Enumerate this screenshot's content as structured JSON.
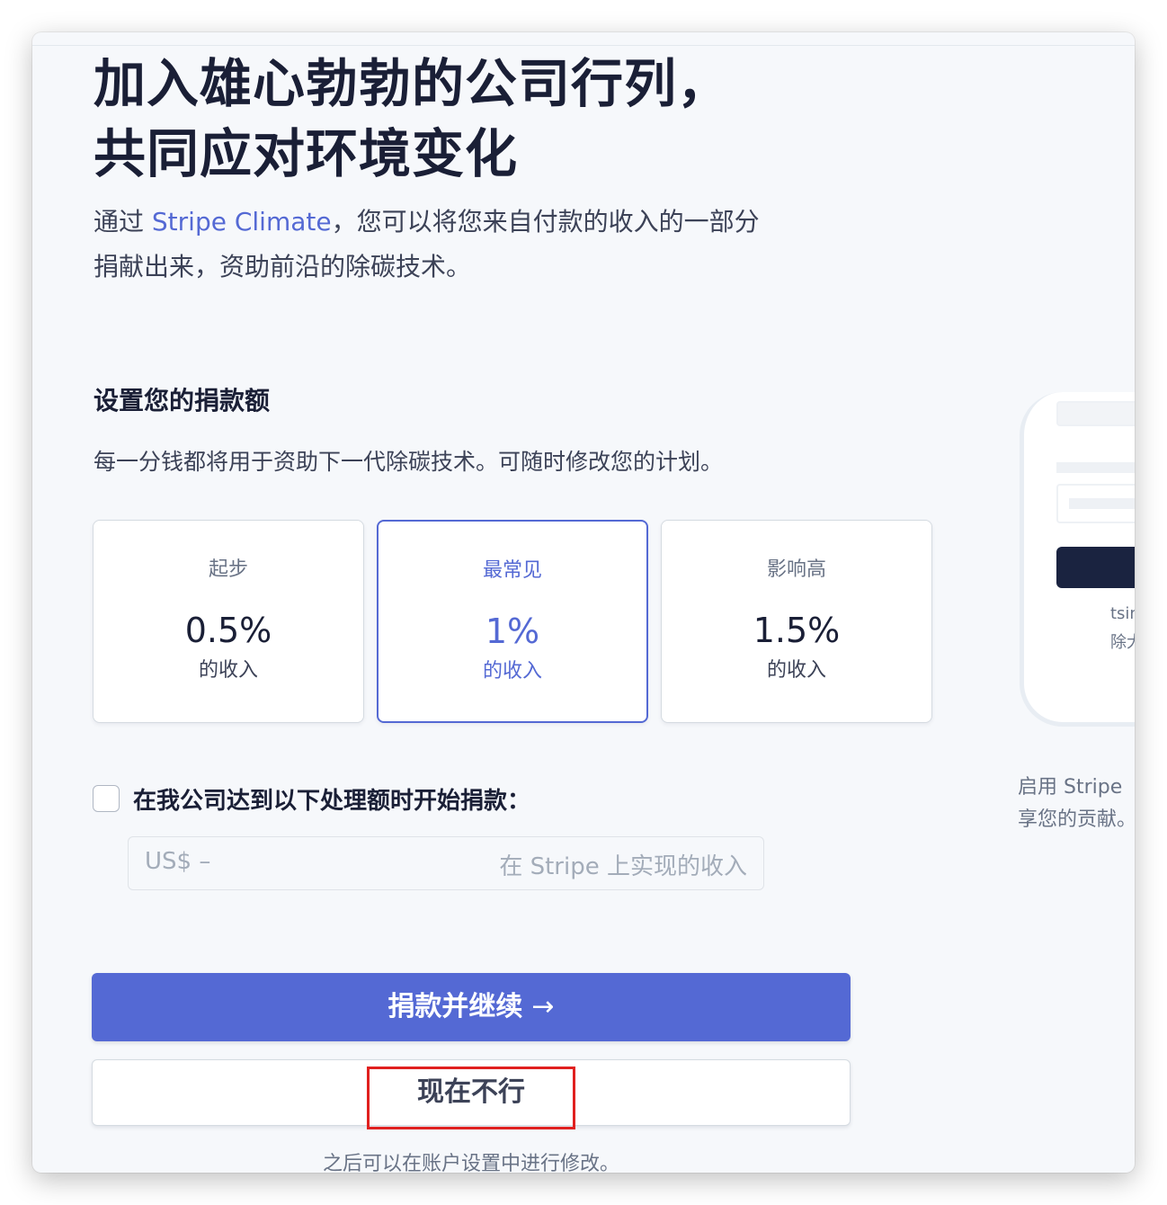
{
  "hero": {
    "title_line1": "加入雄心勃勃的公司行列，",
    "title_line2": "共同应对环境变化",
    "desc_before": "通过 ",
    "desc_link": "Stripe Climate",
    "desc_after": "，您可以将您来自付款的收入的一部分",
    "desc_line2": "捐献出来，资助前沿的除碳技术。"
  },
  "donation": {
    "title": "设置您的捐款额",
    "description": "每一分钱都将用于资助下一代除碳技术。可随时修改您的计划。",
    "options": [
      {
        "name": "起步",
        "percent": "0.5%",
        "unit": "的收入"
      },
      {
        "name": "最常见",
        "percent": "1%",
        "unit": "的收入"
      },
      {
        "name": "影响高",
        "percent": "1.5%",
        "unit": "的收入"
      }
    ],
    "selected_index": 1
  },
  "threshold": {
    "checkbox_label": "在我公司达到以下处理额时开始捐款：",
    "checked": false,
    "prefix": "US$  –",
    "suffix": "在 Stripe 上实现的收入"
  },
  "actions": {
    "primary_label": "捐款并继续",
    "primary_arrow": "→",
    "secondary_label": "现在不行",
    "footnote": "之后可以在账户设置中进行修改。"
  },
  "preview": {
    "text1": "tsin",
    "text2": "除大",
    "caption_line1": "启用 Stripe",
    "caption_line2": "享您的贡献。"
  },
  "colors": {
    "accent": "#5469d4",
    "highlight_box": "#e0201f",
    "text_primary": "#1a1f36"
  }
}
